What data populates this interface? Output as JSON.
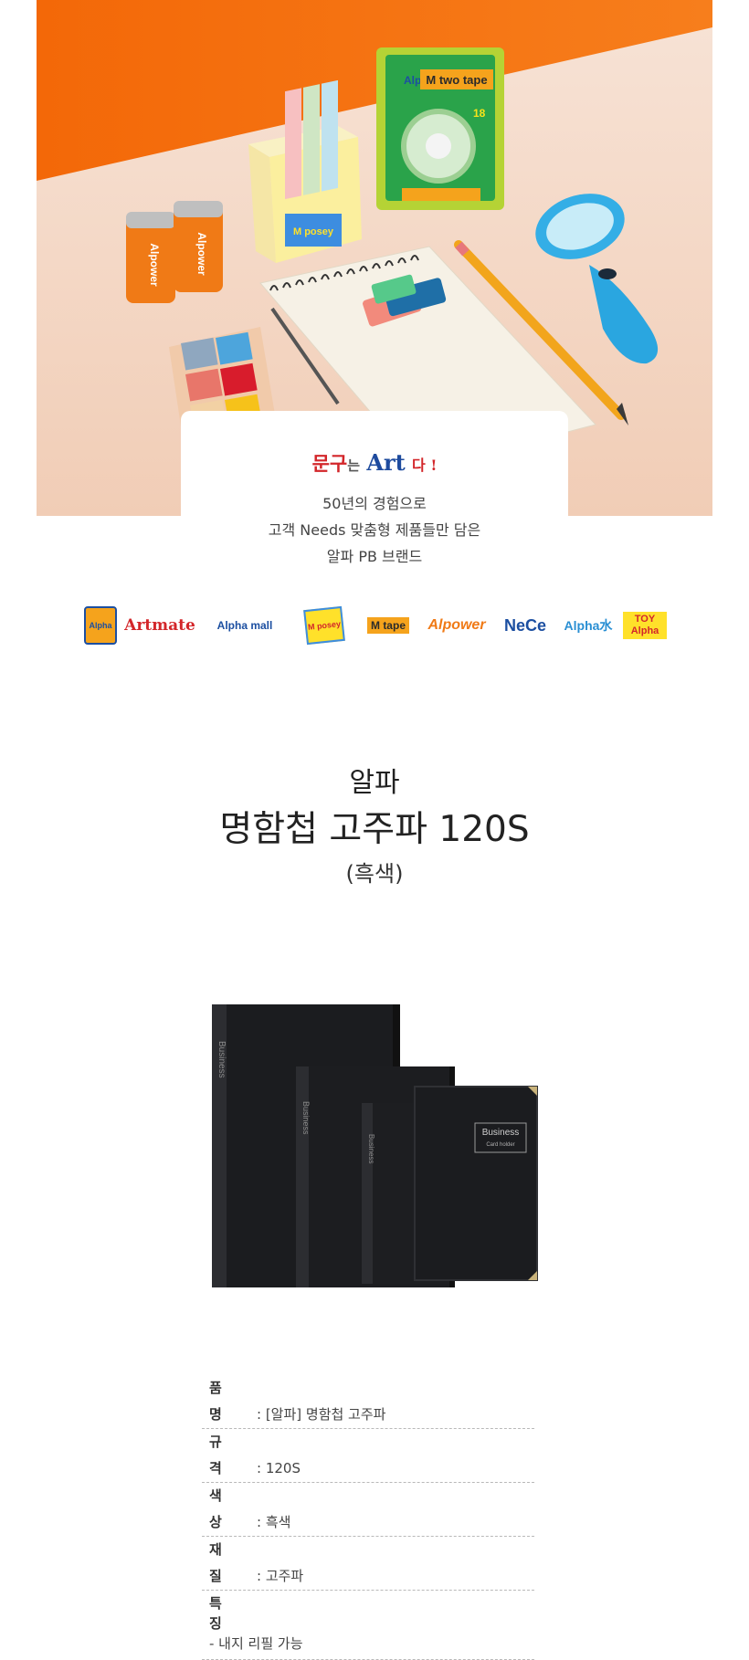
{
  "hero": {
    "slogan": {
      "part1": "문구",
      "part2": "는",
      "part3": "Art",
      "part4": "다 !"
    },
    "product_labels": {
      "tape_brand": "Alpha",
      "tape_name": "M two tape",
      "tape_size": "18",
      "battery_brand": "Alpower",
      "sticky_brand": "M posey"
    }
  },
  "intro": {
    "lines": [
      "50년의 경험으로",
      "고객 Needs 맞춤형 제품들만 담은",
      "알파 PB 브랜드"
    ]
  },
  "brands": [
    {
      "label": "Alpha",
      "icon": "alpha-logo-icon"
    },
    {
      "label": "Artmate",
      "icon": "artmate-logo-icon"
    },
    {
      "label": "Alpha mall",
      "icon": "alphamall-logo-icon"
    },
    {
      "label": "M posey",
      "icon": "mposey-logo-icon"
    },
    {
      "label": "M tape",
      "icon": "mtape-logo-icon"
    },
    {
      "label": "Alpower",
      "icon": "alpower-logo-icon"
    },
    {
      "label": "NeCe",
      "icon": "nece-logo-icon"
    },
    {
      "label": "Alpha水",
      "icon": "alphawater-logo-icon"
    },
    {
      "label": "TOY Alpha",
      "icon": "toyalpha-logo-icon"
    }
  ],
  "title": {
    "brand": "알파",
    "name": "명함첩 고주파 120S",
    "color": "(흑색)"
  },
  "product_image": {
    "cover_text": "Business",
    "cover_subtext": "Card holder"
  },
  "spec": {
    "rows": [
      {
        "key": "품명",
        "value": ": [알파] 명함첩 고주파"
      },
      {
        "key": "규격",
        "value": ": 120S"
      },
      {
        "key": "색상",
        "value": ": 흑색"
      },
      {
        "key": "재질",
        "value": ": 고주파"
      }
    ],
    "feature_key": "특징",
    "feature_note": "-  내지 리필 가능"
  },
  "colors": {
    "hero_orange": "#f26a10",
    "hero_table": "#f6d9c6",
    "slogan_red": "#d3262a",
    "slogan_blue": "#1e4b9e",
    "binder_black": "#1b1c1f"
  }
}
